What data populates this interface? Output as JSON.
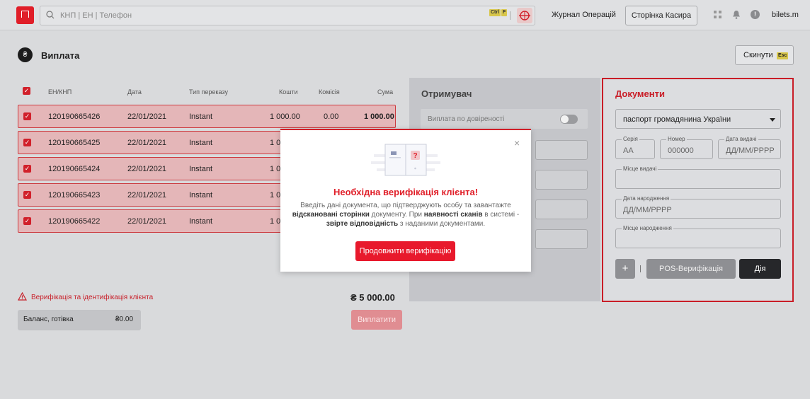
{
  "topbar": {
    "search_placeholder": "КНП | ЕН | Телефон",
    "kbd_ctrl": "Ctrl",
    "kbd_f": "F",
    "journal": "Журнал Операцій",
    "cashier": "Сторінка Касира",
    "username": "bilets.m",
    "alert_glyph": "!"
  },
  "header": {
    "title": "Виплата",
    "reset": "Скинути",
    "reset_kbd": "Esc"
  },
  "table": {
    "headers": {
      "en": "ЕН/КНП",
      "date": "Дата",
      "type": "Тип переказу",
      "funds": "Кошти",
      "fee": "Комісія",
      "sum": "Сума"
    },
    "rows": [
      {
        "en": "120190665426",
        "date": "22/01/2021",
        "type": "Instant",
        "funds": "1 000.00",
        "fee": "0.00",
        "sum": "1 000.00"
      },
      {
        "en": "120190665425",
        "date": "22/01/2021",
        "type": "Instant",
        "funds": "1 00"
      },
      {
        "en": "120190665424",
        "date": "22/01/2021",
        "type": "Instant",
        "funds": "1 00"
      },
      {
        "en": "120190665423",
        "date": "22/01/2021",
        "type": "Instant",
        "funds": "1 00"
      },
      {
        "en": "120190665422",
        "date": "22/01/2021",
        "type": "Instant",
        "funds": "1 00"
      }
    ]
  },
  "footer": {
    "warning": "Верифікація та ідентифікація клієнта",
    "total": "₴ 5 000.00",
    "balance_label": "Баланс, готівка",
    "balance_value": "₴0.00",
    "pay": "Виплатити"
  },
  "recipient": {
    "title": "Отримувач",
    "proxy_label": "Виплата по довіреності"
  },
  "documents": {
    "title": "Документи",
    "doc_type": "паспорт громадянина України",
    "series_label": "Серія",
    "series_placeholder": "АА",
    "number_label": "Номер",
    "number_placeholder": "000000",
    "issue_date_label": "Дата видачі",
    "issue_date_placeholder": "ДД/ММ/РРРР",
    "issue_place_label": "Місце видачі",
    "birth_date_label": "Дата народження",
    "birth_date_placeholder": "ДД/ММ/РРРР",
    "birth_place_label": "Місце народження",
    "plus": "+",
    "pos": "POS-Верифікація",
    "action": "Дія"
  },
  "modal": {
    "title": "Необхідна верифікація клієнта!",
    "body_1": "Введіть дані документа, що підтверджують особу та завантажте ",
    "body_b1": "відскановані сторінки",
    "body_2": " документу. При ",
    "body_b2": "наявності сканів",
    "body_3": " в системі - ",
    "body_b3": "звірте відповідність",
    "body_4": " з наданими документами.",
    "continue": "Продовжити верифікацію",
    "close": "×"
  },
  "colors": {
    "accent": "#e01e28",
    "panel_border": "#c91d27",
    "row_bg": "#e4b6b8"
  }
}
